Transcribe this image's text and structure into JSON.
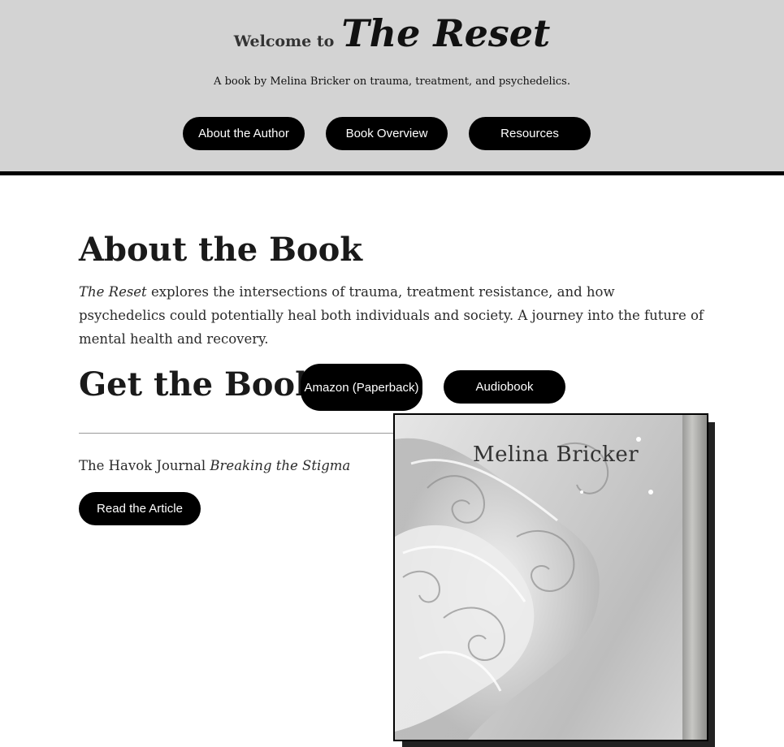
{
  "header": {
    "welcome_small": "Welcome to",
    "welcome_title": "The Reset",
    "tagline": "A book by Melina Bricker on trauma, treatment, and psychedelics.",
    "nav": [
      {
        "label": "About the Author"
      },
      {
        "label": "Book Overview"
      },
      {
        "label": "Resources"
      }
    ]
  },
  "about": {
    "heading": "About the Book",
    "title_italic": "The Reset",
    "text": " explores the intersections of trauma, treatment resistance, and how psychedelics could potentially heal both individuals and society. A journey into the future of mental health and recovery."
  },
  "get": {
    "heading": "Get the Book",
    "amazon_label": "Amazon (Paperback)",
    "audiobook_label": "Audiobook"
  },
  "article": {
    "source": "The Havok Journal",
    "title": "Breaking the Stigma",
    "button_label": "Read the Article"
  },
  "cover": {
    "author": "Melina Bricker"
  },
  "colors": {
    "header_bg": "#d3d3d3",
    "button_bg": "#000000",
    "button_text": "#ffffff"
  }
}
